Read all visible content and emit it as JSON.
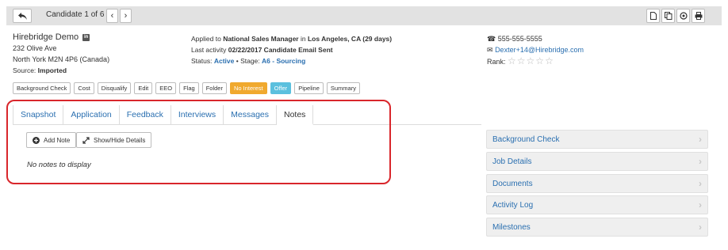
{
  "nav": {
    "title": "Candidate 1 of 6"
  },
  "candidate": {
    "name": "Hirebridge Demo",
    "address1": "232 Olive Ave",
    "address2": "North York M2N 4P6 (Canada)",
    "source_label": "Source:",
    "source_value": "Imported"
  },
  "application": {
    "applied_prefix": "Applied to",
    "job": "National Sales Manager",
    "in_word": "in",
    "location": "Los Angeles, CA (29 days)",
    "activity_prefix": "Last activity",
    "activity_value": "02/22/2017 Candidate Email Sent",
    "status_prefix": "Status:",
    "status_value": "Active",
    "stage_prefix": "• Stage:",
    "stage_value": "A6 - Sourcing"
  },
  "contact": {
    "phone": "555-555-5555",
    "email": "Dexter+14@Hirebridge.com",
    "rank_label": "Rank:",
    "rank_stars": "☆☆☆☆☆"
  },
  "actions": [
    {
      "label": "Background Check",
      "style": "default"
    },
    {
      "label": "Cost",
      "style": "default"
    },
    {
      "label": "Disqualify",
      "style": "default"
    },
    {
      "label": "Edit",
      "style": "default"
    },
    {
      "label": "EEO",
      "style": "default"
    },
    {
      "label": "Flag",
      "style": "default"
    },
    {
      "label": "Folder",
      "style": "default"
    },
    {
      "label": "No Interest",
      "style": "orange"
    },
    {
      "label": "Offer",
      "style": "blue"
    },
    {
      "label": "Pipeline",
      "style": "default"
    },
    {
      "label": "Summary",
      "style": "default"
    }
  ],
  "tabs": [
    {
      "label": "Snapshot",
      "active": false
    },
    {
      "label": "Application",
      "active": false
    },
    {
      "label": "Feedback",
      "active": false
    },
    {
      "label": "Interviews",
      "active": false
    },
    {
      "label": "Messages",
      "active": false
    },
    {
      "label": "Notes",
      "active": true
    }
  ],
  "notes": {
    "add_label": "Add Note",
    "toggle_label": "Show/Hide Details",
    "empty_text": "No notes to display"
  },
  "panels": [
    {
      "label": "Background Check"
    },
    {
      "label": "Job Details"
    },
    {
      "label": "Documents"
    },
    {
      "label": "Activity Log"
    },
    {
      "label": "Milestones"
    }
  ],
  "colors": {
    "link": "#2a6fb0",
    "no_interest": "#f0a92e",
    "offer": "#5bc0de",
    "highlight": "#d9262b"
  }
}
